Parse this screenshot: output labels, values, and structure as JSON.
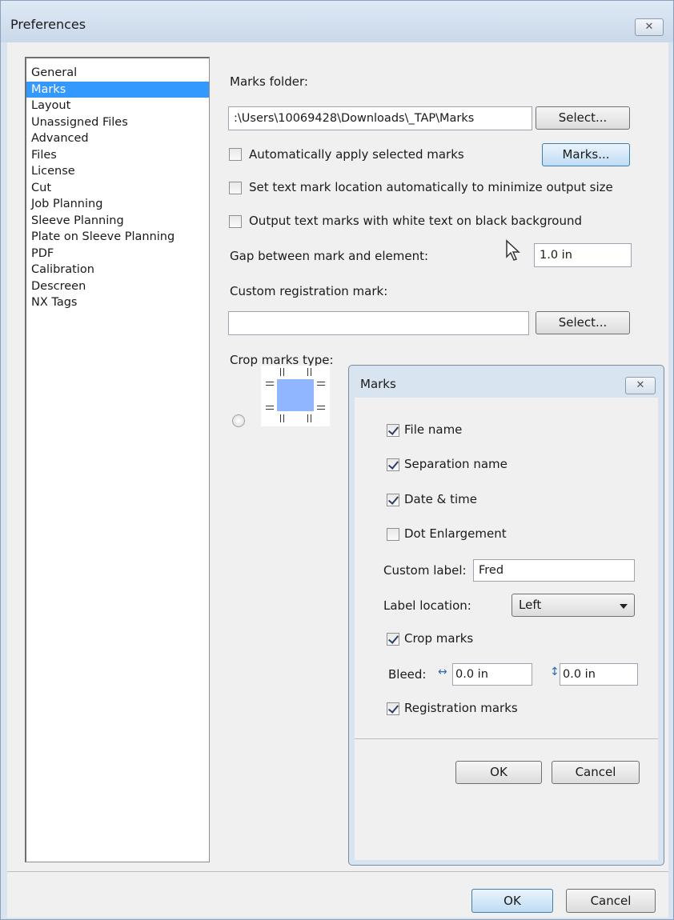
{
  "window": {
    "title": "Preferences",
    "close_glyph": "✕"
  },
  "sidebar": {
    "items": [
      {
        "label": "General",
        "selected": false
      },
      {
        "label": "Marks",
        "selected": true
      },
      {
        "label": "Layout",
        "selected": false
      },
      {
        "label": "Unassigned Files",
        "selected": false
      },
      {
        "label": "Advanced",
        "selected": false
      },
      {
        "label": "Files",
        "selected": false
      },
      {
        "label": "License",
        "selected": false
      },
      {
        "label": "Cut",
        "selected": false
      },
      {
        "label": "Job Planning",
        "selected": false
      },
      {
        "label": "Sleeve Planning",
        "selected": false
      },
      {
        "label": "Plate on Sleeve Planning",
        "selected": false
      },
      {
        "label": "PDF",
        "selected": false
      },
      {
        "label": "Calibration",
        "selected": false
      },
      {
        "label": "Descreen",
        "selected": false
      },
      {
        "label": "NX Tags",
        "selected": false
      }
    ]
  },
  "marks_page": {
    "marks_folder_label": "Marks folder:",
    "marks_folder_value": ":\\Users\\10069428\\Downloads\\_TAP\\Marks",
    "select_button": "Select...",
    "auto_apply_label": "Automatically apply selected marks",
    "auto_apply_checked": false,
    "marks_button": "Marks...",
    "set_location_label": "Set text mark location automatically to minimize output size",
    "set_location_checked": false,
    "white_text_label": "Output text marks with white text on black background",
    "white_text_checked": false,
    "gap_label": "Gap between mark and element:",
    "gap_value": "1.0 in",
    "custom_reg_label": "Custom registration mark:",
    "custom_reg_value": "",
    "custom_reg_select_button": "Select...",
    "crop_marks_type_label": "Crop marks type:"
  },
  "marks_dialog": {
    "title": "Marks",
    "close_glyph": "✕",
    "file_name_label": "File name",
    "file_name_checked": true,
    "separation_name_label": "Separation name",
    "separation_name_checked": true,
    "date_time_label": "Date & time",
    "date_time_checked": true,
    "dot_enlargement_label": "Dot Enlargement",
    "dot_enlargement_checked": false,
    "custom_label_label": "Custom label:",
    "custom_label_value": "Fred",
    "label_location_label": "Label location:",
    "label_location_value": "Left",
    "crop_marks_label": "Crop marks",
    "crop_marks_checked": true,
    "bleed_label": "Bleed:",
    "bleed_horizontal_icon": "↔",
    "bleed_horizontal_value": "0.0 in",
    "bleed_vertical_icon": "↕",
    "bleed_vertical_value": "0.0 in",
    "registration_marks_label": "Registration marks",
    "registration_marks_checked": true,
    "ok_button": "OK",
    "cancel_button": "Cancel"
  },
  "footer": {
    "ok_button": "OK",
    "cancel_button": "Cancel"
  },
  "colors": {
    "selection": "#3399ff",
    "window_frame": "#d9e4f1",
    "crop_box": "#8fb6ff"
  }
}
